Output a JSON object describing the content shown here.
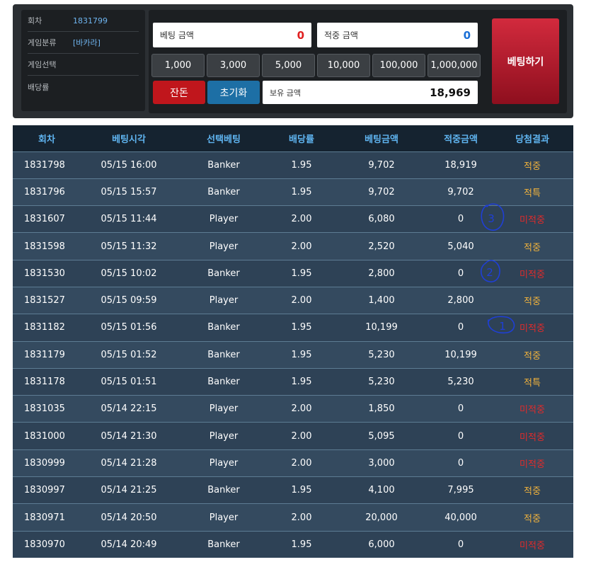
{
  "info": {
    "rows": [
      {
        "key": "회차",
        "value": "1831799"
      },
      {
        "key": "게임분류",
        "value": "[바카라]"
      },
      {
        "key": "게임선택",
        "value": ""
      },
      {
        "key": "배당률",
        "value": ""
      }
    ]
  },
  "bet_panel": {
    "bet_amount_label": "베팅 금액",
    "bet_amount_value": "0",
    "win_amount_label": "적중 금액",
    "win_amount_value": "0",
    "chips": [
      "1,000",
      "3,000",
      "5,000",
      "10,000",
      "100,000",
      "1,000,000"
    ],
    "change_label": "잔돈",
    "reset_label": "초기화",
    "balance_label": "보유 금액",
    "balance_value": "18,969",
    "bet_button_label": "베팅하기"
  },
  "colors": {
    "bet_amount": "#e02020",
    "win_amount": "#1a6fd6",
    "win_result": "#f0b23c",
    "lose_result": "#e02b2b",
    "change_button": "#c0161c",
    "reset_button": "#1d6fa5",
    "annotation_ink": "#1f3fd6"
  },
  "table": {
    "headers": [
      "회차",
      "베팅시각",
      "선택베팅",
      "배당률",
      "베팅금액",
      "적중금액",
      "당첨결과"
    ],
    "rows": [
      {
        "round": "1831798",
        "time": "05/15 16:00",
        "pick": "Banker",
        "odds": "1.95",
        "bet": "9,702",
        "win": "18,919",
        "result": "적중",
        "status": "win"
      },
      {
        "round": "1831796",
        "time": "05/15 15:57",
        "pick": "Banker",
        "odds": "1.95",
        "bet": "9,702",
        "win": "9,702",
        "result": "적특",
        "status": "win"
      },
      {
        "round": "1831607",
        "time": "05/15 11:44",
        "pick": "Player",
        "odds": "2.00",
        "bet": "6,080",
        "win": "0",
        "result": "미적중",
        "status": "lose"
      },
      {
        "round": "1831598",
        "time": "05/15 11:32",
        "pick": "Player",
        "odds": "2.00",
        "bet": "2,520",
        "win": "5,040",
        "result": "적중",
        "status": "win"
      },
      {
        "round": "1831530",
        "time": "05/15 10:02",
        "pick": "Banker",
        "odds": "1.95",
        "bet": "2,800",
        "win": "0",
        "result": "미적중",
        "status": "lose"
      },
      {
        "round": "1831527",
        "time": "05/15 09:59",
        "pick": "Player",
        "odds": "2.00",
        "bet": "1,400",
        "win": "2,800",
        "result": "적중",
        "status": "win"
      },
      {
        "round": "1831182",
        "time": "05/15 01:56",
        "pick": "Banker",
        "odds": "1.95",
        "bet": "10,199",
        "win": "0",
        "result": "미적중",
        "status": "lose"
      },
      {
        "round": "1831179",
        "time": "05/15 01:52",
        "pick": "Banker",
        "odds": "1.95",
        "bet": "5,230",
        "win": "10,199",
        "result": "적중",
        "status": "win"
      },
      {
        "round": "1831178",
        "time": "05/15 01:51",
        "pick": "Banker",
        "odds": "1.95",
        "bet": "5,230",
        "win": "5,230",
        "result": "적특",
        "status": "win"
      },
      {
        "round": "1831035",
        "time": "05/14 22:15",
        "pick": "Player",
        "odds": "2.00",
        "bet": "1,850",
        "win": "0",
        "result": "미적중",
        "status": "lose"
      },
      {
        "round": "1831000",
        "time": "05/14 21:30",
        "pick": "Player",
        "odds": "2.00",
        "bet": "5,095",
        "win": "0",
        "result": "미적중",
        "status": "lose"
      },
      {
        "round": "1830999",
        "time": "05/14 21:28",
        "pick": "Player",
        "odds": "2.00",
        "bet": "3,000",
        "win": "0",
        "result": "미적중",
        "status": "lose"
      },
      {
        "round": "1830997",
        "time": "05/14 21:25",
        "pick": "Banker",
        "odds": "1.95",
        "bet": "4,100",
        "win": "7,995",
        "result": "적중",
        "status": "win"
      },
      {
        "round": "1830971",
        "time": "05/14 20:50",
        "pick": "Player",
        "odds": "2.00",
        "bet": "20,000",
        "win": "40,000",
        "result": "적중",
        "status": "win"
      },
      {
        "round": "1830970",
        "time": "05/14 20:49",
        "pick": "Banker",
        "odds": "1.95",
        "bet": "6,000",
        "win": "0",
        "result": "미적중",
        "status": "lose"
      }
    ]
  },
  "annotations": [
    "3",
    "2",
    "1"
  ]
}
